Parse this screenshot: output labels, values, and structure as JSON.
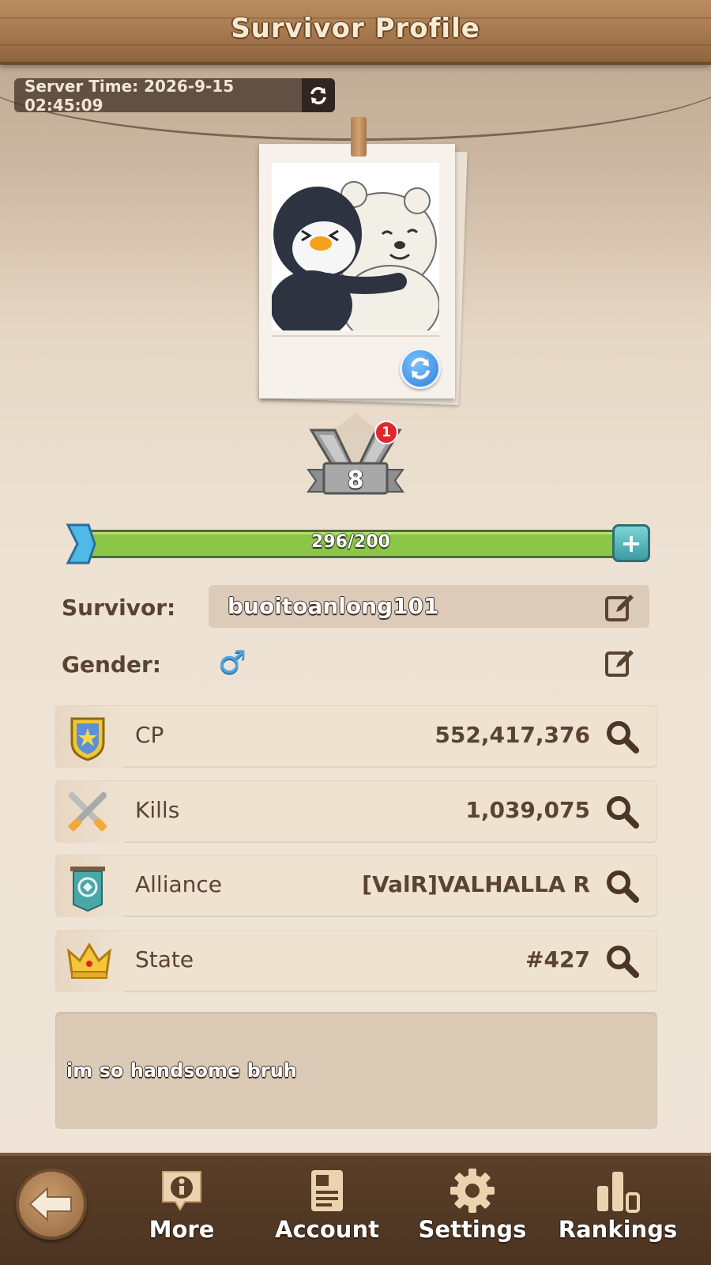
{
  "header": {
    "title": "Survivor Profile"
  },
  "server_time": {
    "label": "Server Time: 2026-9-15 02:45:09"
  },
  "rank": {
    "level": "8",
    "notification_count": "1"
  },
  "xp": {
    "text": "296/200",
    "progress": 1.0
  },
  "profile": {
    "survivor_label": "Survivor:",
    "survivor_name": "buoitoanlong101",
    "gender_label": "Gender:",
    "gender_symbol": "♂"
  },
  "stats": [
    {
      "label": "CP",
      "value": "552,417,376",
      "icon": "shield-star-icon"
    },
    {
      "label": "Kills",
      "value": "1,039,075",
      "icon": "crossed-swords-icon"
    },
    {
      "label": "Alliance",
      "value": "[ValR]VALHALLA R",
      "icon": "alliance-banner-icon"
    },
    {
      "label": "State",
      "value": "#427",
      "icon": "crown-icon"
    }
  ],
  "bio": {
    "text": "im so handsome bruh"
  },
  "footer": {
    "more": "More",
    "account": "Account",
    "settings": "Settings",
    "rankings": "Rankings"
  },
  "colors": {
    "xp_green": "#8cc646",
    "wood_dark": "#4c3421",
    "text_brown": "#5a4331",
    "plus_teal": "#3a9da3"
  }
}
